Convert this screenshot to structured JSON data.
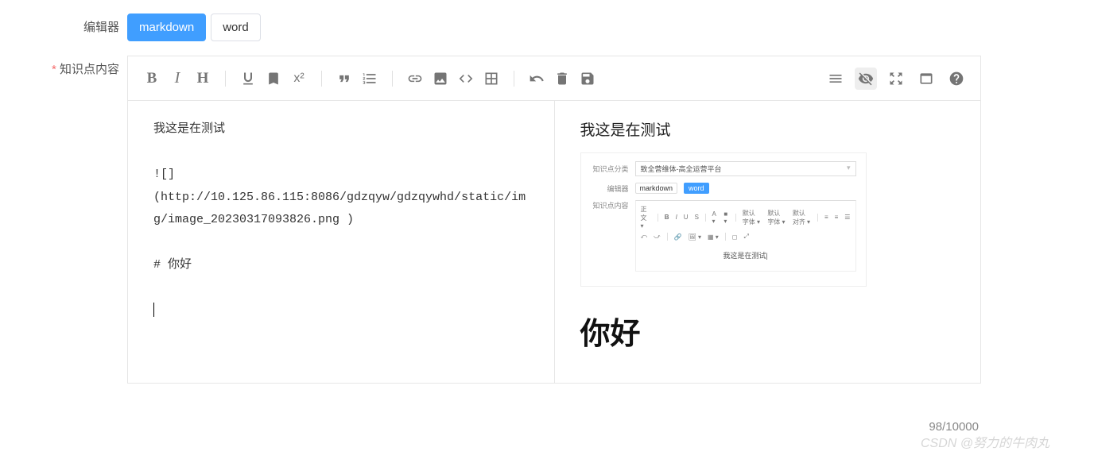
{
  "labels": {
    "editor": "编辑器",
    "content": "知识点内容"
  },
  "tabs": {
    "markdown": "markdown",
    "word": "word"
  },
  "toolbar": {
    "bold": "B",
    "italic": "I",
    "heading": "H",
    "underline": "U",
    "bookmark": "🔖",
    "sup": "x²",
    "quote": "❝",
    "list": "≣",
    "link": "🔗",
    "image": "🖼",
    "code": "</>",
    "table": "▦",
    "undo": "↺",
    "trash": "🗑",
    "save": "💾",
    "toc": "≡",
    "preview": "👁",
    "expand": "⤢",
    "window": "▭",
    "help": "?"
  },
  "source": {
    "line1": "我这是在测试",
    "line2": "![]",
    "line3": "(http://10.125.86.115:8086/gdzqyw/gdzqywhd/static/img/image_20230317093826.png )",
    "line4": "# 你好"
  },
  "preview": {
    "title": "我这是在测试",
    "heading": "你好",
    "embedded": {
      "row1_label": "知识点分类",
      "row1_value": "致全营维体-高全运营平台",
      "row2_label": "编辑器",
      "tag_md": "markdown",
      "tag_word": "word",
      "row3_label": "知识点内容",
      "tb_items": [
        "正文 ▾",
        "B",
        "I",
        "U",
        "S",
        "A ▾",
        "■ ▾",
        "默认字体 ▾",
        "默认字体 ▾",
        "默认对齐 ▾",
        "≡",
        "≡",
        "☰"
      ],
      "tb_items2": [
        "⤺",
        "⤻",
        "🔗",
        "🖼 ▾",
        "▦ ▾",
        "◻",
        "⤢"
      ],
      "content_text": "我这是在测试|"
    }
  },
  "footer": {
    "count": "98/10000",
    "watermark": "CSDN @努力的牛肉丸"
  }
}
